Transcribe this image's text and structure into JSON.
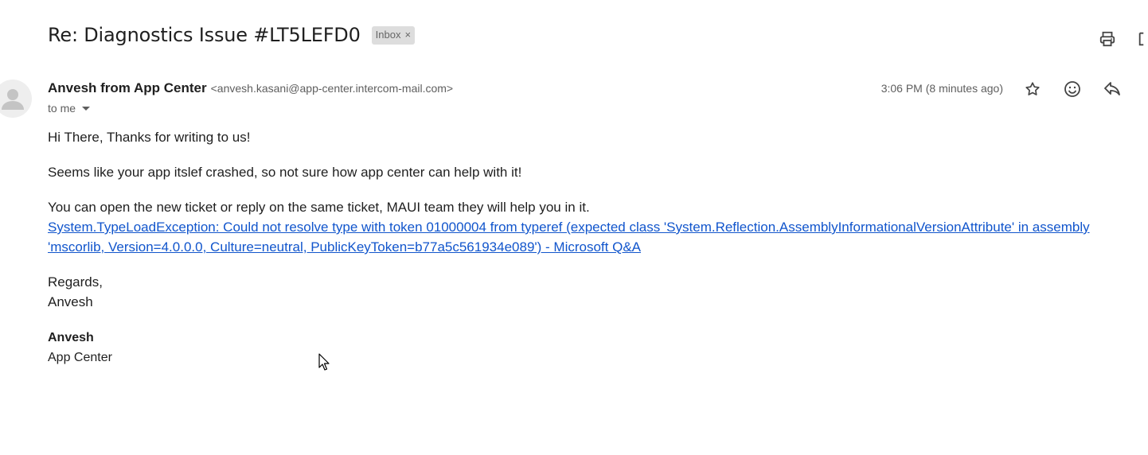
{
  "header": {
    "subject": "Re: Diagnostics Issue #LT5LEFD0",
    "label": "Inbox",
    "label_remove": "×"
  },
  "message": {
    "sender_name": "Anvesh from App Center",
    "sender_email": "<anvesh.kasani@app-center.intercom-mail.com>",
    "recipient": "to me",
    "time": "3:06 PM (8 minutes ago)",
    "body": {
      "greeting": "Hi There, Thanks for writing to us!",
      "para1": "Seems like your app itslef crashed, so not sure how app center can help with it!",
      "para2": "You can open the new ticket or reply on the same ticket, MAUI team they will help you in it.",
      "link_text": "System.TypeLoadException: Could not resolve type with token 01000004 from typeref (expected class 'System.Reflection.AssemblyInformationalVersionAttribute' in assembly 'mscorlib, Version=4.0.0.0, Culture=neutral, PublicKeyToken=b77a5c561934e089') - Microsoft Q&A",
      "closing": "Regards,",
      "closing_name": "Anvesh",
      "signature_name": "Anvesh",
      "signature_org": "App Center"
    }
  },
  "icons": {
    "print": "print-icon",
    "new_window": "open-in-new-window-icon",
    "star": "star-icon",
    "emoji": "emoji-reaction-icon",
    "reply": "reply-icon",
    "avatar": "default-avatar-icon",
    "caret": "caret-down-icon"
  },
  "colors": {
    "link": "#1155cc",
    "chip_bg": "#dddddd",
    "muted_text": "#5e5e5e"
  }
}
